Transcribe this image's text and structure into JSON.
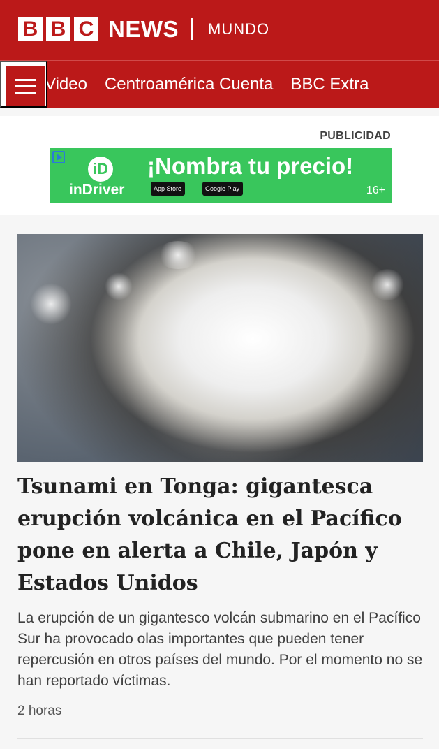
{
  "header": {
    "bbc_letters": [
      "B",
      "B",
      "C"
    ],
    "news_label": "NEWS",
    "edition_label": "MUNDO"
  },
  "nav": {
    "items": [
      {
        "label": "Video"
      },
      {
        "label": "Centroamérica Cuenta"
      },
      {
        "label": "BBC Extra"
      }
    ],
    "menu_icon": "hamburger-menu-icon"
  },
  "advertising": {
    "label": "PUBLICIDAD",
    "brand": "inDriver",
    "logo_text": "iD",
    "headline": "¡Nombra tu precio!",
    "store_badges": [
      "App Store",
      "Google Play"
    ],
    "age_rating": "16+",
    "background_color": "#39c65c"
  },
  "story": {
    "image": "satellite image of volcanic eruption cloud",
    "title": "Tsunami en Tonga: gigantesca erupción volcánica en el Pacífico pone en alerta a Chile, Japón y Estados Unidos",
    "summary": "La erupción de un gigantesco volcán submarino en el Pacífico Sur ha provocado olas importantes que pueden tener repercusión en otros países del mundo. Por el momento no se han reportado víctimas.",
    "time": "2 horas"
  },
  "colors": {
    "brand_red": "#bb1919",
    "ad_green": "#39c65c"
  }
}
